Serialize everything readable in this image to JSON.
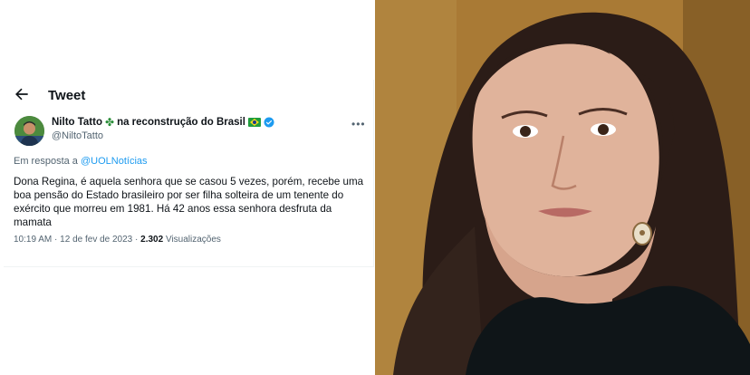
{
  "header": {
    "title": "Tweet"
  },
  "author": {
    "name": "Nilto Tatto",
    "name_suffix": "na reconstrução do Brasil",
    "handle": "@NiltoTatto"
  },
  "reply": {
    "prefix": "Em resposta a",
    "mention": "@UOLNotícias"
  },
  "tweet": {
    "text": "Dona Regina, é aquela senhora que se casou 5 vezes, porém, recebe uma boa pensão do Estado brasileiro por ser filha solteira de um tenente do exército que morreu em 1981. Há 42 anos essa senhora desfruta da mamata"
  },
  "meta": {
    "time": "10:19 AM",
    "separator": "·",
    "date": "12 de fev de 2023",
    "views_count": "2.302",
    "views_label": "Visualizações"
  },
  "colors": {
    "link": "#1d9bf0",
    "text": "#0f1419",
    "muted": "#536471",
    "verified": "#1d9bf0"
  },
  "icons": {
    "back": "left-arrow-icon",
    "more": "more-horizontal-icon",
    "verified": "verified-badge-icon",
    "clover": "four-leaf-clover-icon",
    "flag": "brazil-flag-icon"
  }
}
